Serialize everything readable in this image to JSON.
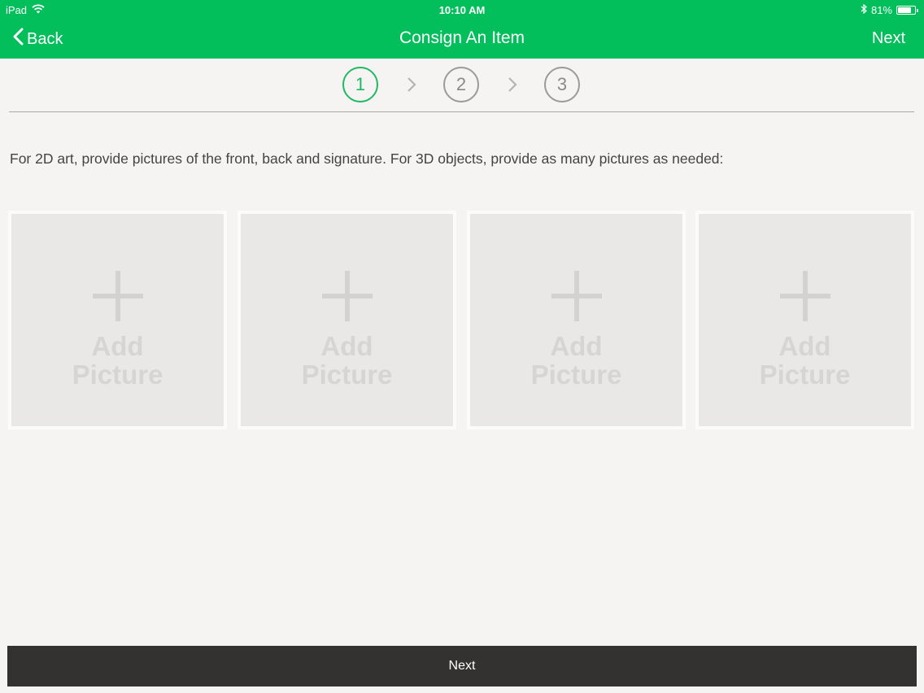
{
  "status_bar": {
    "device": "iPad",
    "time": "10:10 AM",
    "battery_percent": "81%",
    "battery_level": 0.81,
    "icons": [
      "wifi-icon",
      "bluetooth-icon",
      "battery-icon"
    ]
  },
  "nav": {
    "back_label": "Back",
    "title": "Consign An Item",
    "next_label": "Next"
  },
  "steps": [
    {
      "number": "1",
      "active": true
    },
    {
      "number": "2",
      "active": false
    },
    {
      "number": "3",
      "active": false
    }
  ],
  "instructions": "For 2D art, provide pictures of the front, back and signature.  For 3D objects, provide as many pictures as needed:",
  "tiles": [
    {
      "line1": "Add",
      "line2": "Picture"
    },
    {
      "line1": "Add",
      "line2": "Picture"
    },
    {
      "line1": "Add",
      "line2": "Picture"
    },
    {
      "line1": "Add",
      "line2": "Picture"
    }
  ],
  "footer": {
    "next_label": "Next"
  },
  "colors": {
    "brand_green": "#03bf5b",
    "active_step": "#1fb866",
    "footer_bar": "#333231",
    "background": "#f5f4f2"
  }
}
